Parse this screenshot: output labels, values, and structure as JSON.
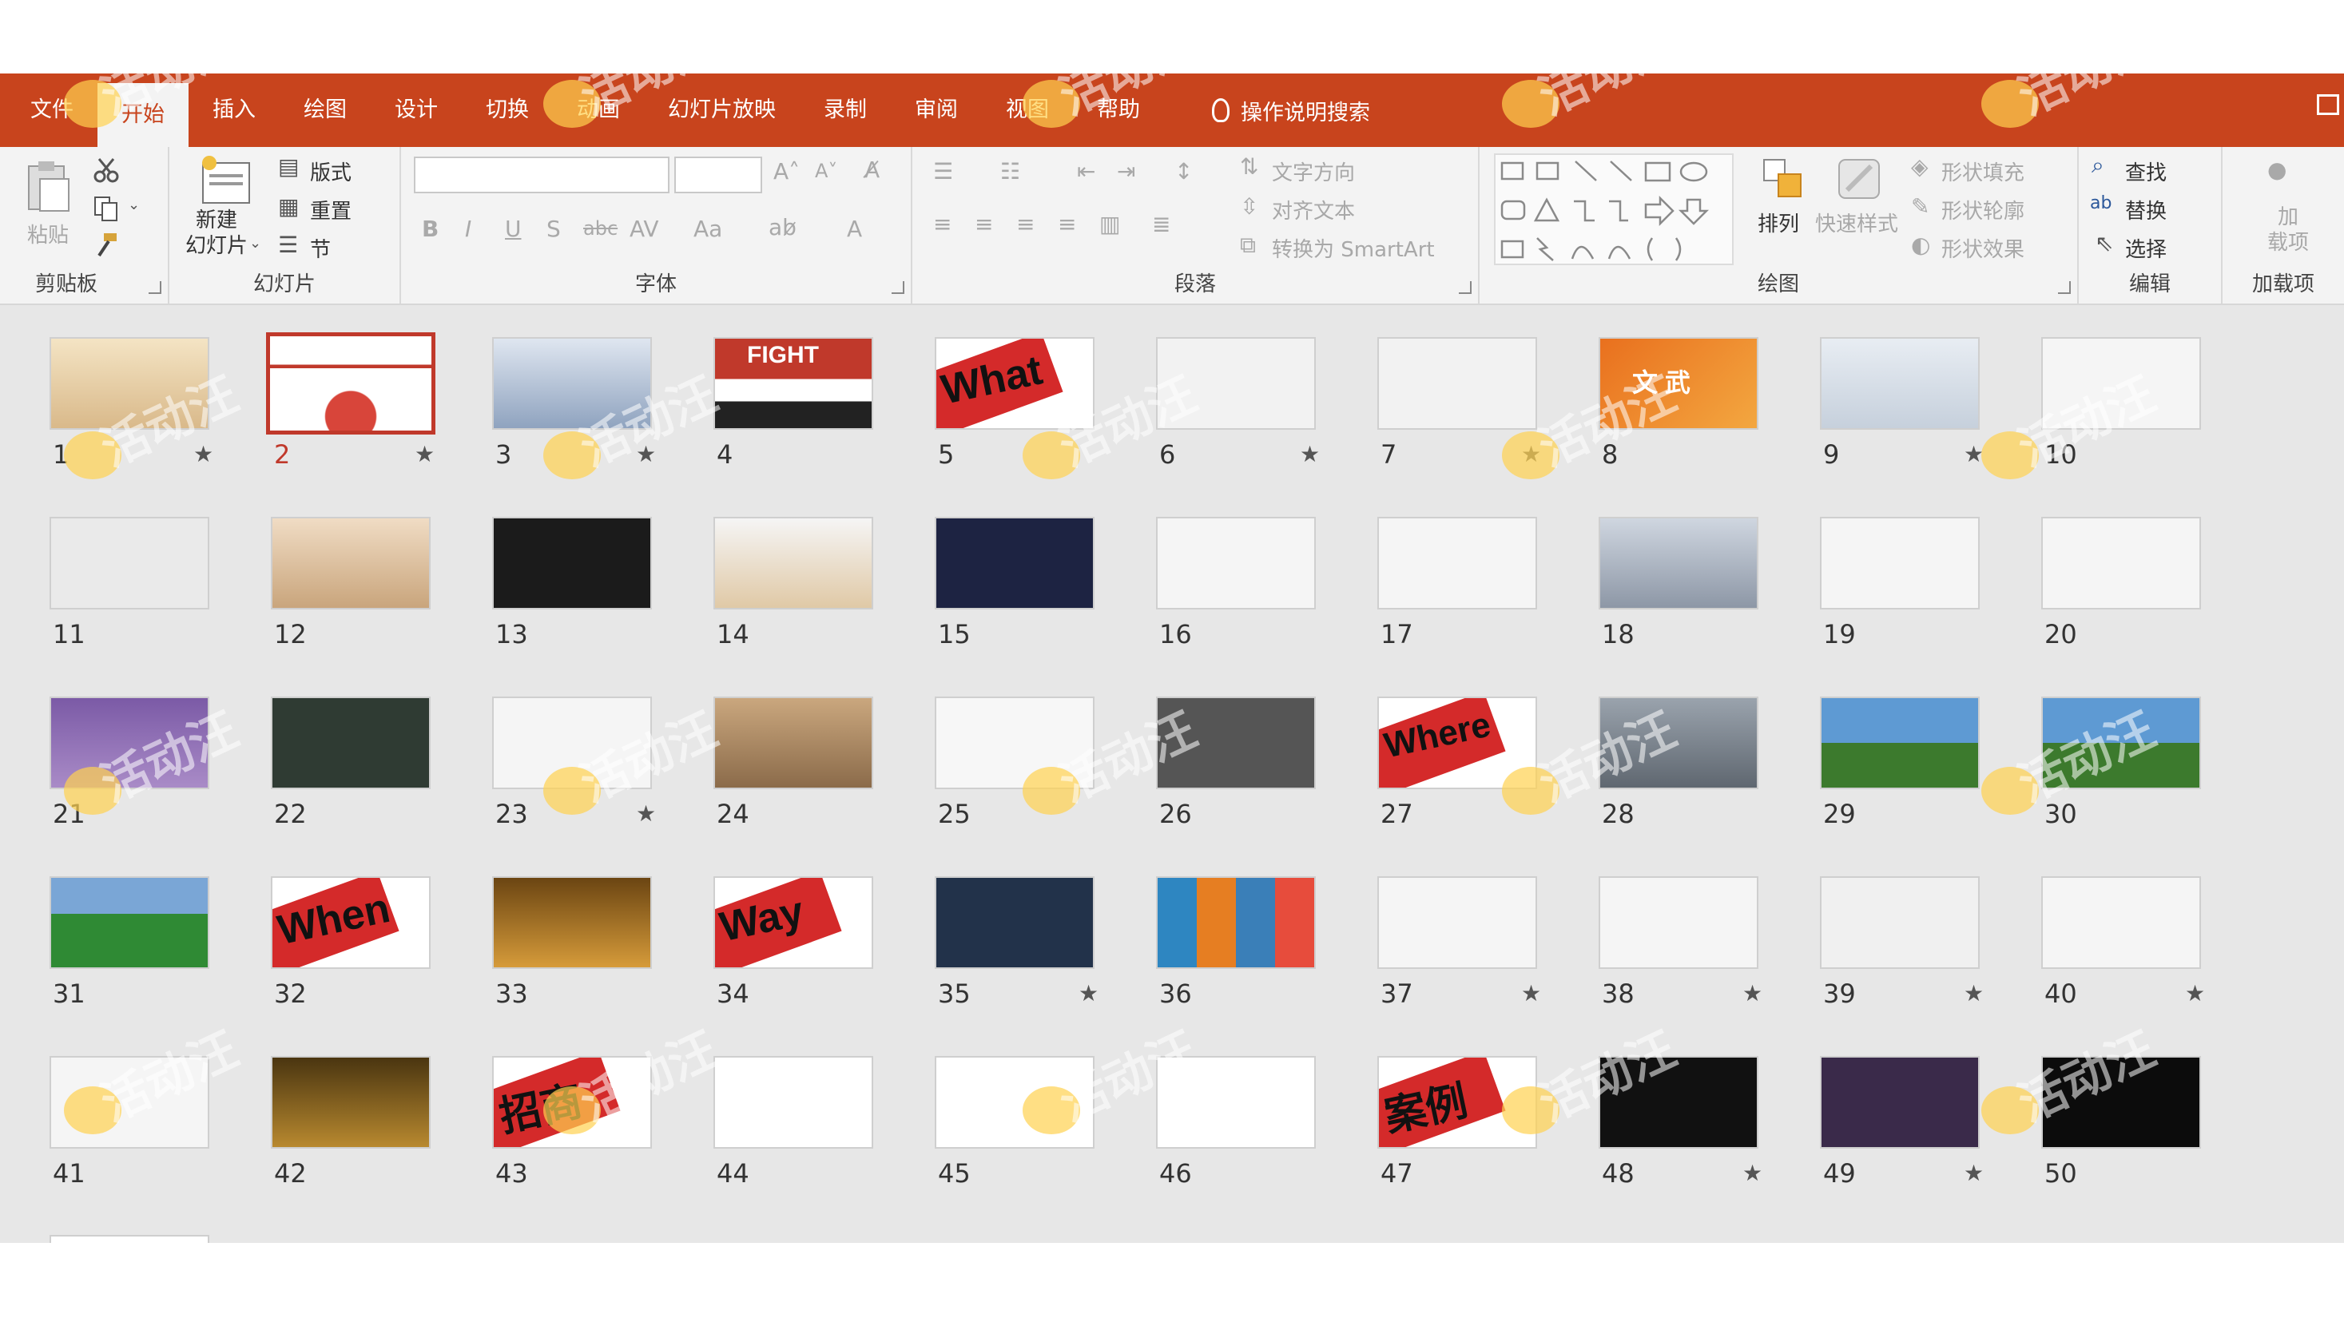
{
  "menu": {
    "items": [
      "文件",
      "开始",
      "插入",
      "绘图",
      "设计",
      "切换",
      "动画",
      "幻灯片放映",
      "录制",
      "审阅",
      "视图",
      "帮助"
    ],
    "active_index": 1,
    "search_label": "操作说明搜索"
  },
  "ribbon": {
    "clipboard": {
      "paste": "粘贴",
      "label": "剪贴板"
    },
    "slides": {
      "new_slide": "新建\n幻灯片",
      "layout": "版式",
      "reset": "重置",
      "section": "节",
      "label": "幻灯片"
    },
    "font": {
      "label": "字体",
      "bold": "B",
      "italic": "I",
      "underline": "U",
      "shadow": "S",
      "strike": "abc",
      "spacing": "AV",
      "case": "Aa",
      "color": "A"
    },
    "paragraph": {
      "label": "段落",
      "text_direction": "文字方向",
      "align_text": "对齐文本",
      "smartart": "转换为 SmartArt"
    },
    "drawing": {
      "label": "绘图",
      "arrange": "排列",
      "quick_styles": "快速样式",
      "shape_fill": "形状填充",
      "shape_outline": "形状轮廓",
      "shape_effects": "形状效果"
    },
    "editing": {
      "label": "编辑",
      "find": "查找",
      "replace": "替换",
      "select": "选择"
    },
    "addins": {
      "label": "加载项",
      "button": "加\n载项"
    }
  },
  "colors": {
    "accent": "#c8441d",
    "ribbon_bg": "#f3f3f3",
    "sorter_bg": "#e7e7e7",
    "selected": "#c0392b"
  },
  "slides": [
    {
      "n": "1",
      "star": true,
      "style": "banner"
    },
    {
      "n": "2",
      "star": true,
      "style": "banner-red",
      "selected": true
    },
    {
      "n": "3",
      "star": true,
      "style": "chart"
    },
    {
      "n": "4",
      "star": false,
      "style": "fight",
      "text": "FIGHT"
    },
    {
      "n": "5",
      "star": false,
      "style": "word",
      "text": "What"
    },
    {
      "n": "6",
      "star": true,
      "style": "circles"
    },
    {
      "n": "7",
      "star": true,
      "style": "ribbon"
    },
    {
      "n": "8",
      "star": false,
      "style": "orange",
      "text": "文 武"
    },
    {
      "n": "9",
      "star": true,
      "style": "mountain"
    },
    {
      "n": "10",
      "star": false,
      "style": "clock"
    },
    {
      "n": "11",
      "star": false,
      "style": "stadium"
    },
    {
      "n": "12",
      "star": false,
      "style": "pen"
    },
    {
      "n": "13",
      "star": false,
      "style": "dark"
    },
    {
      "n": "14",
      "star": false,
      "style": "dog"
    },
    {
      "n": "15",
      "star": false,
      "style": "darkgrid"
    },
    {
      "n": "16",
      "star": false,
      "style": "photos"
    },
    {
      "n": "17",
      "star": false,
      "style": "photos"
    },
    {
      "n": "18",
      "star": false,
      "style": "fight2"
    },
    {
      "n": "19",
      "star": false,
      "style": "phone"
    },
    {
      "n": "20",
      "star": false,
      "style": "laptop"
    },
    {
      "n": "21",
      "star": false,
      "style": "purple"
    },
    {
      "n": "22",
      "star": false,
      "style": "green"
    },
    {
      "n": "23",
      "star": true,
      "style": "photos"
    },
    {
      "n": "24",
      "star": false,
      "style": "brown"
    },
    {
      "n": "25",
      "star": false,
      "style": "map"
    },
    {
      "n": "26",
      "star": false,
      "style": "person"
    },
    {
      "n": "27",
      "star": false,
      "style": "word",
      "text": "Where"
    },
    {
      "n": "28",
      "star": false,
      "style": "circles2"
    },
    {
      "n": "29",
      "star": false,
      "style": "building"
    },
    {
      "n": "30",
      "star": false,
      "style": "building"
    },
    {
      "n": "31",
      "star": false,
      "style": "field"
    },
    {
      "n": "32",
      "star": false,
      "style": "word",
      "text": "When"
    },
    {
      "n": "33",
      "star": false,
      "style": "gold"
    },
    {
      "n": "34",
      "star": false,
      "style": "word",
      "text": "Way"
    },
    {
      "n": "35",
      "star": true,
      "style": "megaphone"
    },
    {
      "n": "36",
      "star": false,
      "style": "columns"
    },
    {
      "n": "37",
      "star": true,
      "style": "billboard"
    },
    {
      "n": "38",
      "star": true,
      "style": "billboard2"
    },
    {
      "n": "39",
      "star": true,
      "style": "billboard3"
    },
    {
      "n": "40",
      "star": true,
      "style": "billboard2"
    },
    {
      "n": "41",
      "star": false,
      "style": "table"
    },
    {
      "n": "42",
      "star": false,
      "style": "gold2"
    },
    {
      "n": "43",
      "star": false,
      "style": "word",
      "text": "招商"
    },
    {
      "n": "44",
      "star": false,
      "style": "doc"
    },
    {
      "n": "45",
      "star": false,
      "style": "doc"
    },
    {
      "n": "46",
      "star": false,
      "style": "doc"
    },
    {
      "n": "47",
      "star": false,
      "style": "word",
      "text": "案例"
    },
    {
      "n": "48",
      "star": true,
      "style": "black"
    },
    {
      "n": "49",
      "star": true,
      "style": "collage"
    },
    {
      "n": "50",
      "star": false,
      "style": "black2"
    }
  ],
  "watermark": "活动汪"
}
